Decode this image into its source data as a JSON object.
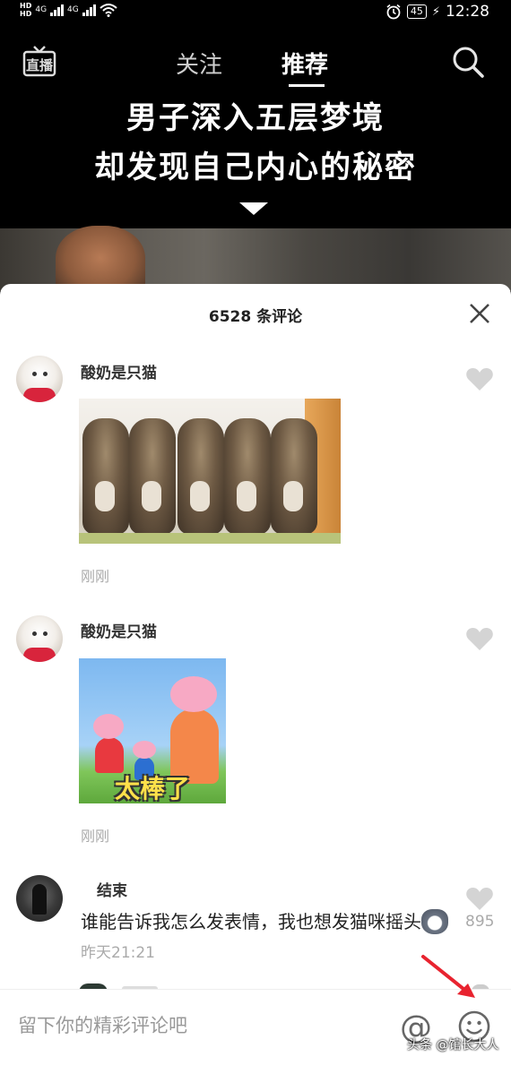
{
  "status_bar": {
    "network_1": "4G",
    "network_2": "4G",
    "hd_labels": [
      "HD",
      "HD"
    ],
    "battery": "45",
    "time": "12:28"
  },
  "top_nav": {
    "live_label": "直播",
    "tabs": [
      {
        "label": "关注",
        "active": false
      },
      {
        "label": "推荐",
        "active": true
      }
    ]
  },
  "video": {
    "headline_line1": "男子深入五层梦境",
    "headline_line2": "却发现自己内心的秘密"
  },
  "comments_sheet": {
    "title": "6528 条评论",
    "comments": [
      {
        "user": "酸奶是只猫",
        "image": "kittens-gif",
        "time": "刚刚"
      },
      {
        "user": "酸奶是只猫",
        "image": "peppa-pig-sticker",
        "image_caption": "太棒了",
        "time": "刚刚"
      },
      {
        "user": "结束",
        "text": "谁能告诉我怎么发表情，我也想发猫咪摇头",
        "inline_emoji": "husky-sticker",
        "time": "昨天21:21",
        "likes": "895"
      }
    ]
  },
  "input_bar": {
    "placeholder": "留下你的精彩评论吧"
  },
  "watermark": "头条 @馆长大人",
  "colors": {
    "accent_red": "#e8232f",
    "muted_text": "#aaaaaa",
    "heart_gray": "#d4d4d4"
  }
}
